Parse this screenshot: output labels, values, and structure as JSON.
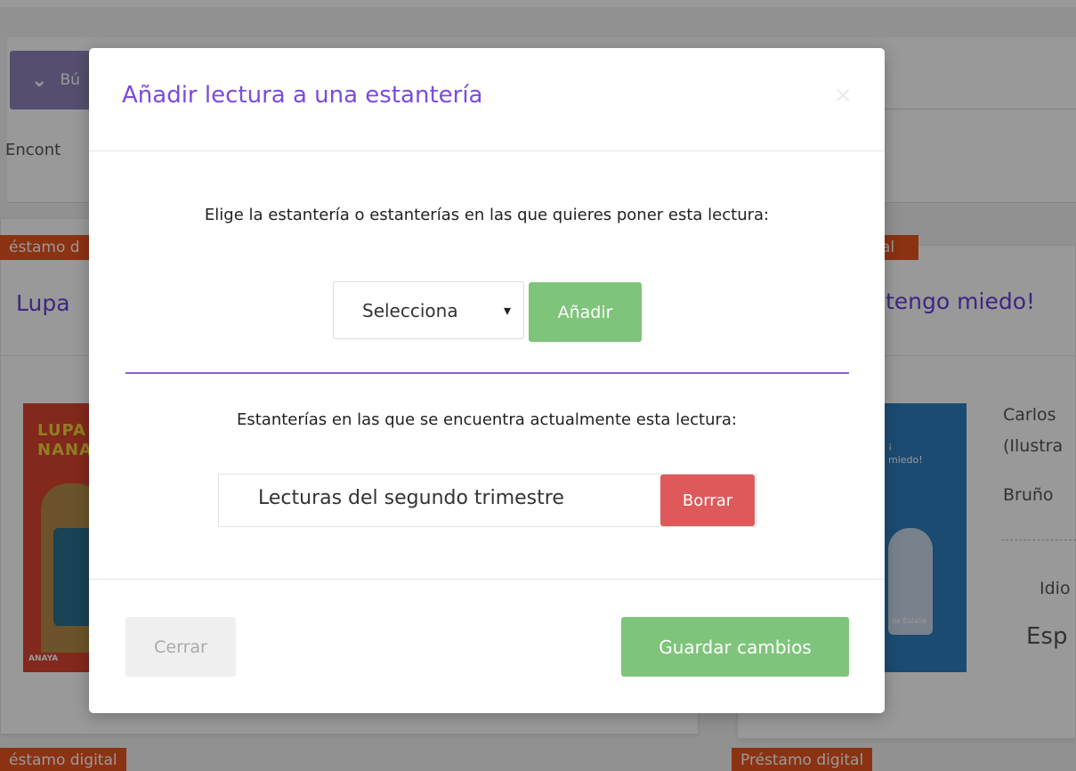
{
  "background": {
    "search_button_label": "Bú",
    "found_text": "Encont",
    "left_card": {
      "badge": "éstamo d",
      "title": "Lupa",
      "cover_title_line1": "LUPA",
      "cover_title_line2": "NANA",
      "cover_publisher": "ANAYA"
    },
    "right_card": {
      "badge": "al",
      "title": "tengo miedo!",
      "cover_title_line1": "¡",
      "cover_title_line2": "miedo!",
      "cover_publisher": "de Eulalia",
      "author_line1": "Carlos",
      "author_line2": "(Ilustra",
      "publisher": "Bruño",
      "language_label": "Idio",
      "language_value": "Esp"
    },
    "bottom_left_badge": "éstamo digital",
    "bottom_right_badge": "Préstamo digital"
  },
  "modal": {
    "title": "Añadir lectura a una estantería",
    "close_symbol": "×",
    "prompt": "Elige la estantería o estanterías en las que quieres poner esta lectura:",
    "select_value": "Selecciona",
    "add_button": "Añadir",
    "current_label": "Estanterías en las que se encuentra actualmente esta lectura:",
    "shelves": [
      {
        "name": "Lecturas del segundo trimestre",
        "delete_label": "Borrar"
      }
    ],
    "close_button": "Cerrar",
    "save_button": "Guardar cambios"
  },
  "colors": {
    "accent_purple": "#7a4be0",
    "green_button": "#7fc47b",
    "red_button": "#de5a5a",
    "badge_orange": "#e8541f"
  }
}
